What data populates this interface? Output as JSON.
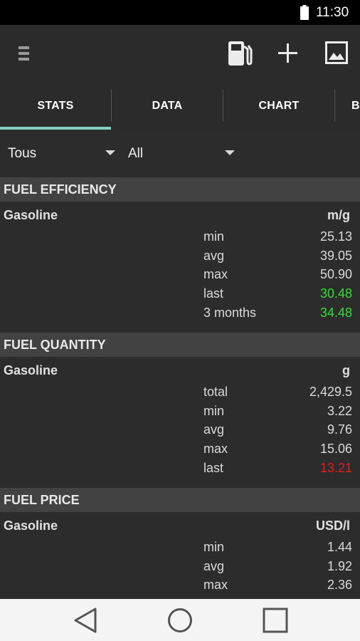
{
  "status_bar": {
    "time": "11:30",
    "battery_icon": "battery-full-icon"
  },
  "toolbar": {
    "menu_icon": "menu-icon",
    "fuel_icon": "fuel-pump-icon",
    "add_icon": "add-icon",
    "image_icon": "image-icon"
  },
  "tabs": [
    {
      "label": "STATS",
      "selected": true
    },
    {
      "label": "DATA",
      "selected": false
    },
    {
      "label": "CHART",
      "selected": false
    },
    {
      "label": "BI",
      "selected": false
    }
  ],
  "filters": {
    "vehicle": "Tous",
    "period": "All"
  },
  "sections": [
    {
      "title": "FUEL EFFICIENCY",
      "fuel": "Gasoline",
      "unit": "m/g",
      "rows": [
        {
          "label": "min",
          "value": "25.13",
          "color": "#dadada"
        },
        {
          "label": "avg",
          "value": "39.05",
          "color": "#dadada"
        },
        {
          "label": "max",
          "value": "50.90",
          "color": "#dadada"
        },
        {
          "label": "last",
          "value": "30.48",
          "color": "#33e033"
        },
        {
          "label": "3 months",
          "value": "34.48",
          "color": "#33e033"
        }
      ]
    },
    {
      "title": "FUEL QUANTITY",
      "fuel": "Gasoline",
      "unit": "g",
      "rows": [
        {
          "label": "total",
          "value": "2,429.5",
          "color": "#dadada"
        },
        {
          "label": "min",
          "value": "3.22",
          "color": "#dadada"
        },
        {
          "label": "avg",
          "value": "9.76",
          "color": "#dadada"
        },
        {
          "label": "max",
          "value": "15.06",
          "color": "#dadada"
        },
        {
          "label": "last",
          "value": "13.21",
          "color": "#e81c1c"
        }
      ]
    },
    {
      "title": "FUEL PRICE",
      "fuel": "Gasoline",
      "unit": "USD/l",
      "rows": [
        {
          "label": "min",
          "value": "1.44",
          "color": "#dadada"
        },
        {
          "label": "avg",
          "value": "1.92",
          "color": "#dadada"
        },
        {
          "label": "max",
          "value": "2.36",
          "color": "#dadada"
        }
      ]
    }
  ],
  "nav_bar": {
    "back_icon": "back-icon",
    "home_icon": "home-icon",
    "recents_icon": "recents-icon"
  }
}
